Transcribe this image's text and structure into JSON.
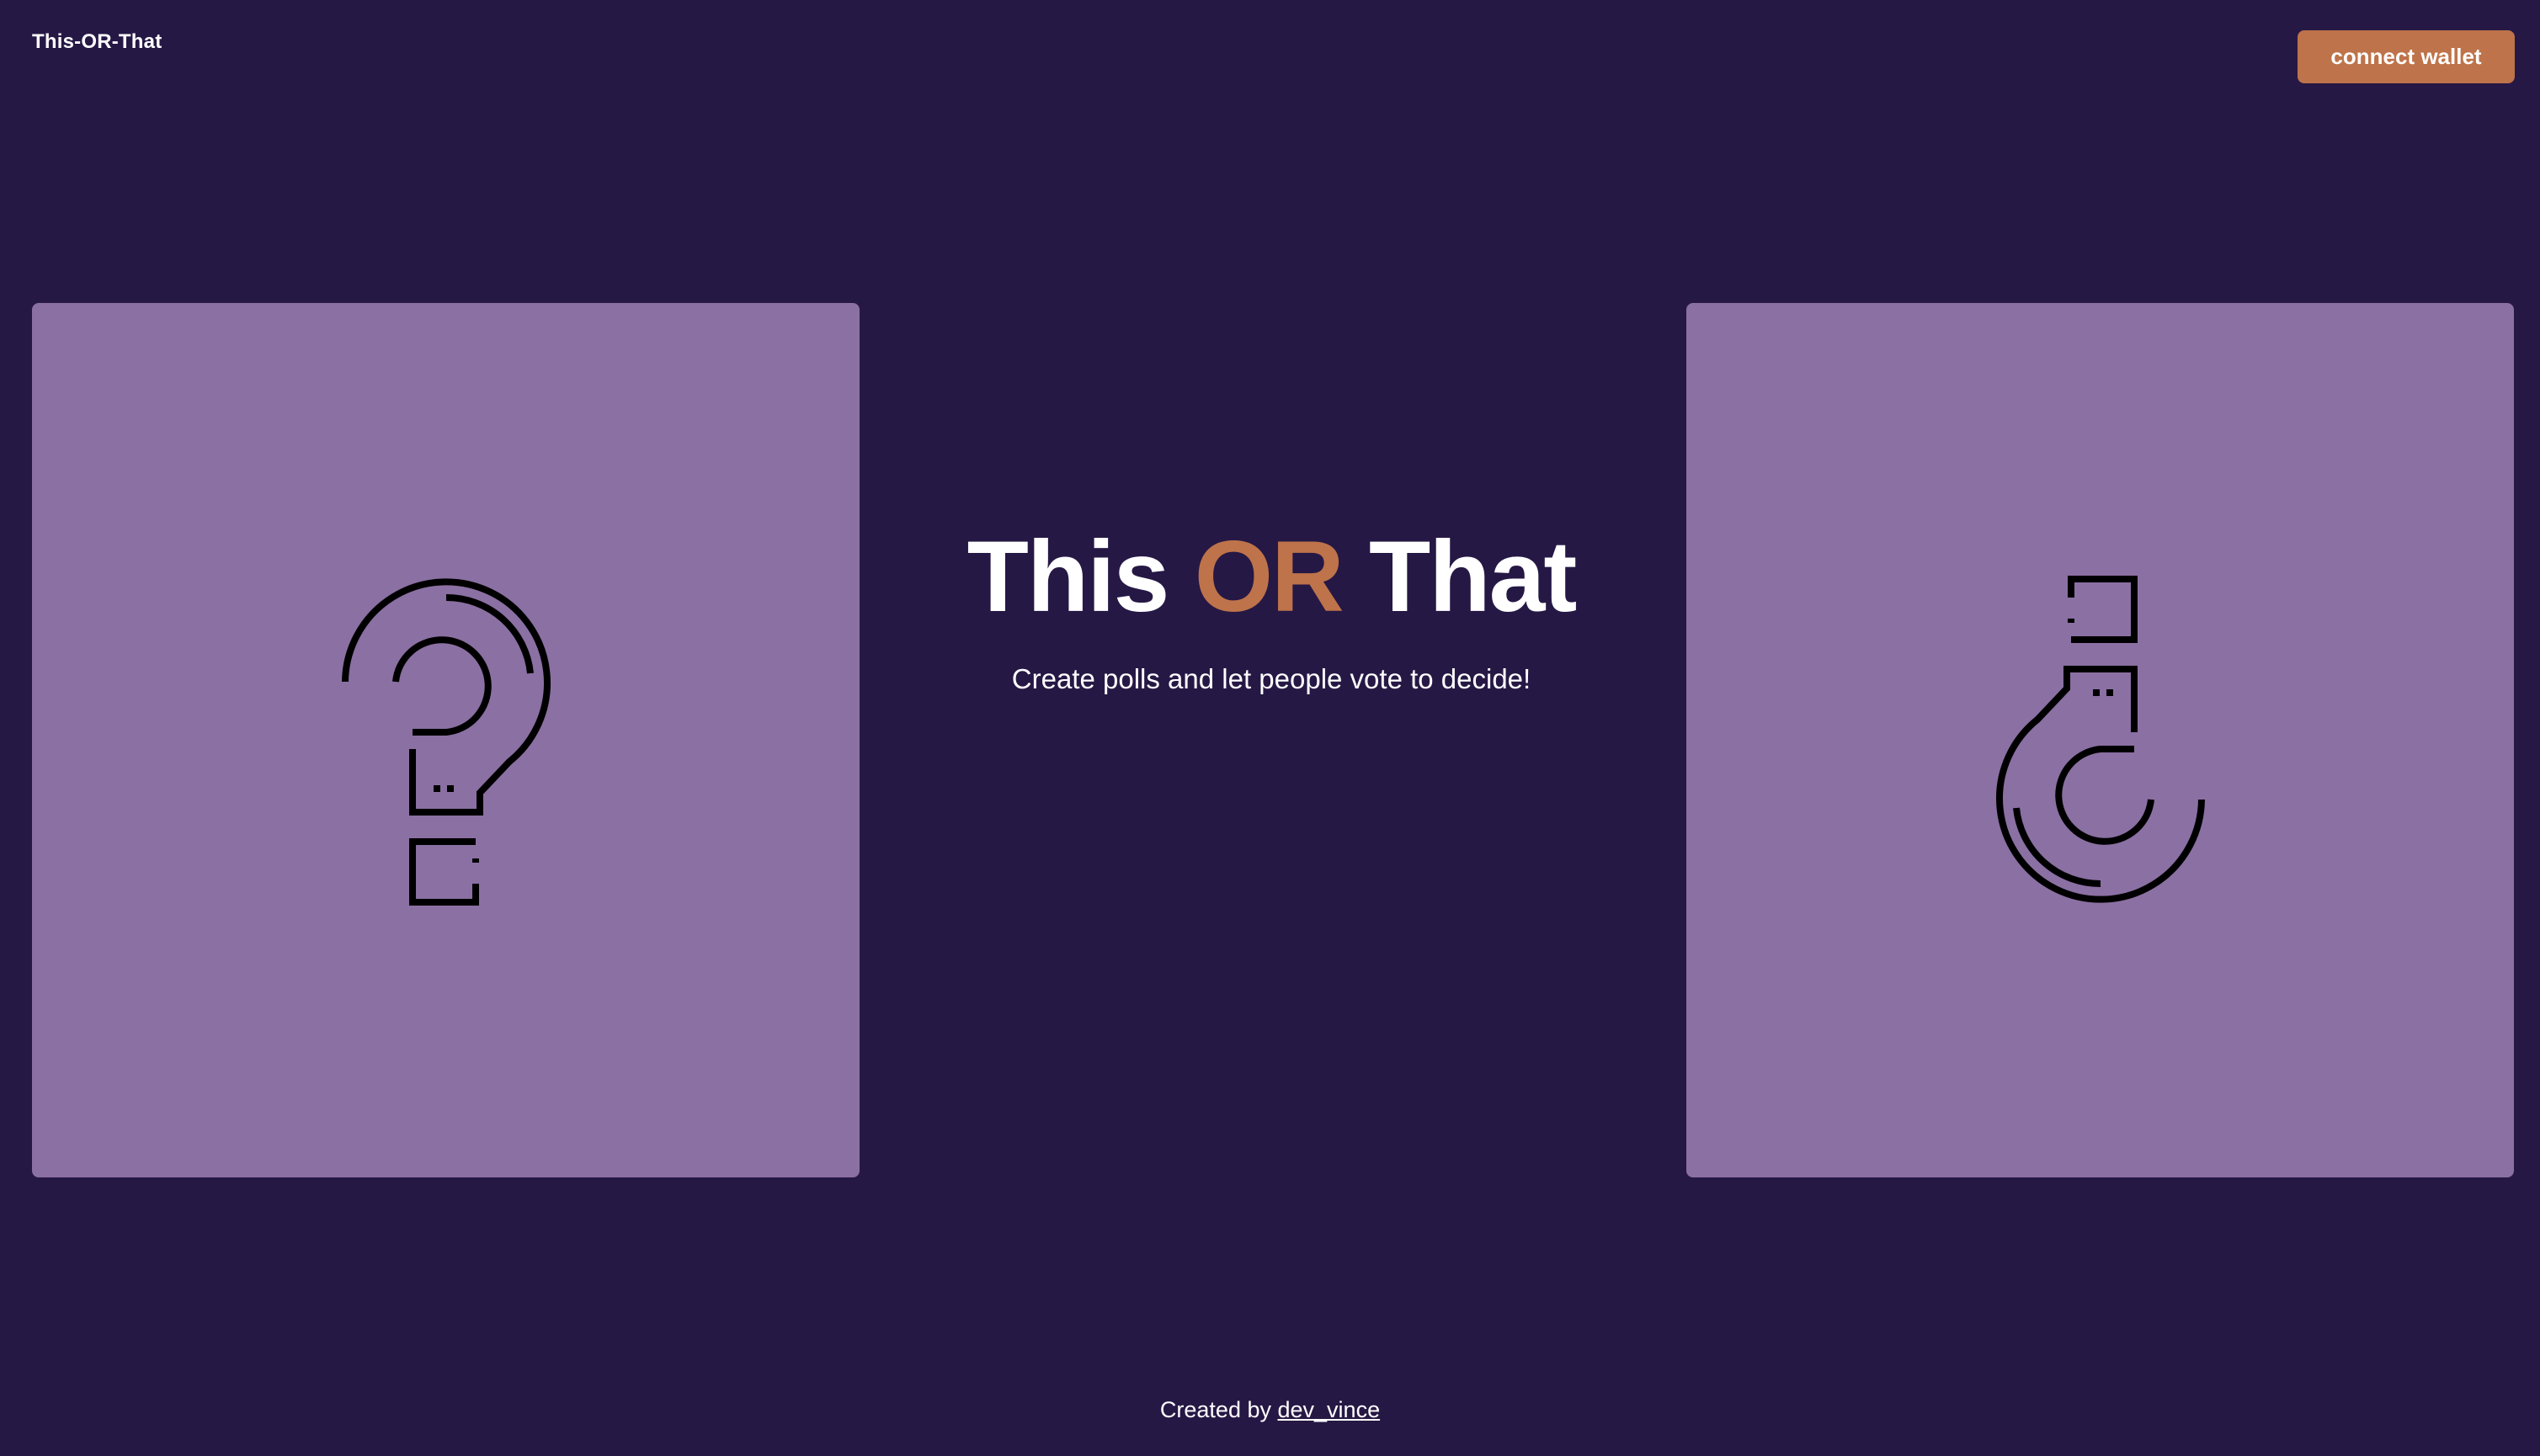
{
  "header": {
    "brand": "This-OR-That",
    "connect_label": "connect wallet"
  },
  "hero": {
    "title_this": "This",
    "title_or": "OR",
    "title_that": "That",
    "subtitle": "Create polls and let people vote to decide!"
  },
  "footer": {
    "prefix": "Created by",
    "author": "dev_vince"
  },
  "icons": {
    "left_card": "question-mark-icon",
    "right_card": "inverted-question-mark-icon"
  },
  "colors": {
    "background": "#261845",
    "card": "#8b70a3",
    "accent": "#be734a",
    "text": "#ffffff"
  }
}
